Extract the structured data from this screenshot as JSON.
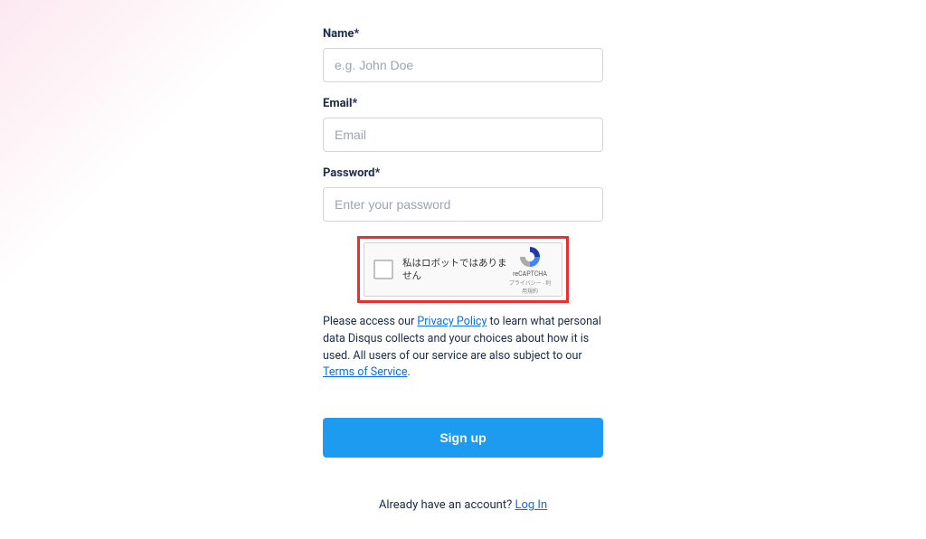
{
  "form": {
    "name": {
      "label": "Name*",
      "placeholder": "e.g. John Doe"
    },
    "email": {
      "label": "Email*",
      "placeholder": "Email"
    },
    "password": {
      "label": "Password*",
      "placeholder": "Enter your password"
    }
  },
  "recaptcha": {
    "text": "私はロボットではありません",
    "brand": "reCAPTCHA",
    "links": "プライバシー - 利用規約"
  },
  "privacy": {
    "prefix": "Please access our ",
    "policy_link": "Privacy Policy",
    "middle": " to learn what personal data Disqus collects and your choices about how it is used. All users of our service are also subject to our ",
    "tos_link": "Terms of Service",
    "suffix": "."
  },
  "buttons": {
    "signup": "Sign up"
  },
  "login": {
    "prompt": "Already have an account? ",
    "link": "Log In"
  }
}
